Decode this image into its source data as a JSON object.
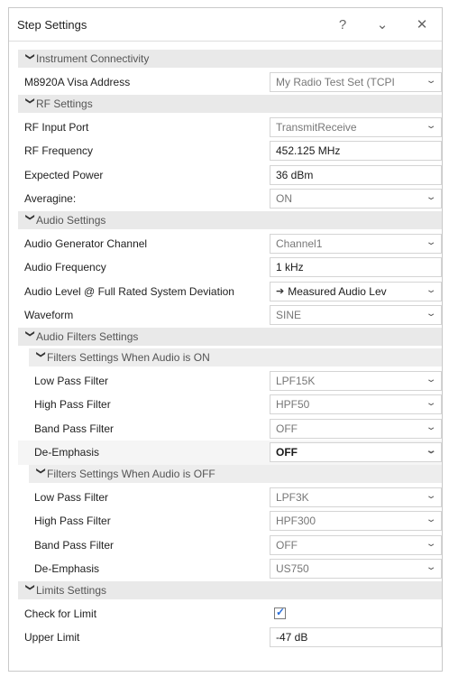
{
  "window": {
    "title": "Step Settings",
    "help": "?",
    "collapse": "⌄",
    "close": "✕"
  },
  "sections": {
    "instrument": "Instrument Connectivity",
    "rf": "RF Settings",
    "audio": "Audio Settings",
    "filters": "Audio Filters Settings",
    "filters_on": "Filters Settings When Audio is ON",
    "filters_off": "Filters Settings When Audio is OFF",
    "limits": "Limits Settings"
  },
  "instrument": {
    "visa_label": "M8920A Visa Address",
    "visa_value": "My Radio Test Set (TCPI"
  },
  "rf": {
    "port_label": "RF Input Port",
    "port_value": "TransmitReceive",
    "freq_label": "RF Frequency",
    "freq_value": "452.125 MHz",
    "power_label": "Expected Power",
    "power_value": "36 dBm",
    "avg_label": "Averagine:",
    "avg_value": "ON"
  },
  "audio": {
    "gen_label": "Audio Generator Channel",
    "gen_value": "Channel1",
    "freq_label": "Audio Frequency",
    "freq_value": "1 kHz",
    "level_label": "Audio Level @ Full Rated System Deviation",
    "level_value": "Measured Audio Lev",
    "wave_label": "Waveform",
    "wave_value": "SINE"
  },
  "filters_on": {
    "lpf_label": "Low Pass Filter",
    "lpf_value": "LPF15K",
    "hpf_label": "High Pass Filter",
    "hpf_value": "HPF50",
    "bpf_label": "Band Pass Filter",
    "bpf_value": "OFF",
    "de_label": "De-Emphasis",
    "de_value": "OFF"
  },
  "filters_off": {
    "lpf_label": "Low Pass Filter",
    "lpf_value": "LPF3K",
    "hpf_label": "High Pass Filter",
    "hpf_value": "HPF300",
    "bpf_label": "Band Pass Filter",
    "bpf_value": "OFF",
    "de_label": "De-Emphasis",
    "de_value": "US750"
  },
  "limits": {
    "check_label": "Check for Limit",
    "check_checked": true,
    "upper_label": "Upper Limit",
    "upper_value": "-47 dB"
  }
}
